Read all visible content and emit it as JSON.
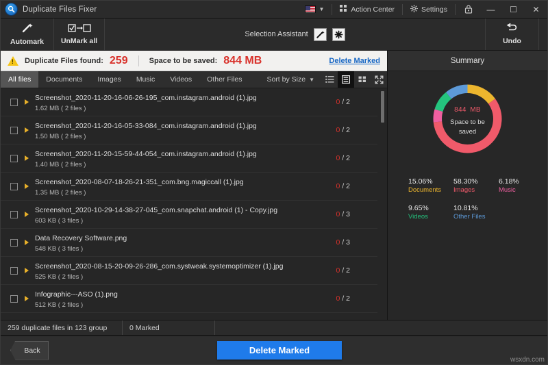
{
  "window": {
    "title": "Duplicate Files Fixer",
    "logo_icon": "magnifier-logo-icon",
    "lang_icon": "us-flag-icon",
    "action_center_label": "Action Center",
    "action_center_icon": "grid-icon",
    "settings_label": "Settings",
    "settings_icon": "gear-icon",
    "help_icon": "help-lock-icon",
    "minimize_icon": "—",
    "maximize_icon": "☐",
    "close_icon": "✕"
  },
  "toolbar": {
    "automark_label": "Automark",
    "automark_icon": "magic-wand-icon",
    "unmark_all_label": "UnMark all",
    "unmark_all_icon": "checkbox-to-empty-icon",
    "selection_assistant_label": "Selection Assistant",
    "selection_assistant_wand_icon": "magic-wand-icon",
    "selection_assistant_star_icon": "asterisk-icon",
    "undo_label": "Undo",
    "undo_icon": "undo-arrow-icon"
  },
  "notice": {
    "warning_icon": "warning-triangle-icon",
    "found_label": "Duplicate Files found:",
    "found_value": "259",
    "space_label": "Space to be saved:",
    "space_value": "844 MB",
    "delete_marked_link": "Delete Marked"
  },
  "tabs": {
    "items": [
      {
        "label": "All files",
        "active": true
      },
      {
        "label": "Documents",
        "active": false
      },
      {
        "label": "Images",
        "active": false
      },
      {
        "label": "Music",
        "active": false
      },
      {
        "label": "Videos",
        "active": false
      },
      {
        "label": "Other Files",
        "active": false
      }
    ],
    "sort_label": "Sort by Size",
    "sort_caret_icon": "chevron-down-icon",
    "views": [
      {
        "name": "list-view-icon",
        "active": false
      },
      {
        "name": "detail-view-icon",
        "active": true
      },
      {
        "name": "grid-view-icon",
        "active": false
      },
      {
        "name": "expand-view-icon",
        "active": false
      }
    ]
  },
  "file_list": {
    "rows": [
      {
        "name": "Screenshot_2020-11-20-16-06-26-195_com.instagram.android (1).jpg",
        "meta": "1.62 MB  ( 2 files )",
        "marked": "0",
        "total": "2"
      },
      {
        "name": "Screenshot_2020-11-20-16-05-33-084_com.instagram.android (1).jpg",
        "meta": "1.50 MB  ( 2 files )",
        "marked": "0",
        "total": "2"
      },
      {
        "name": "Screenshot_2020-11-20-15-59-44-054_com.instagram.android (1).jpg",
        "meta": "1.40 MB  ( 2 files )",
        "marked": "0",
        "total": "2"
      },
      {
        "name": "Screenshot_2020-08-07-18-26-21-351_com.bng.magiccall (1).jpg",
        "meta": "1.35 MB  ( 2 files )",
        "marked": "0",
        "total": "2"
      },
      {
        "name": "Screenshot_2020-10-29-14-38-27-045_com.snapchat.android (1) - Copy.jpg",
        "meta": "603 KB  ( 3 files )",
        "marked": "0",
        "total": "3"
      },
      {
        "name": "Data Recovery Software.png",
        "meta": "548 KB  ( 3 files )",
        "marked": "0",
        "total": "3"
      },
      {
        "name": "Screenshot_2020-08-15-20-09-26-286_com.systweak.systemoptimizer (1).jpg",
        "meta": "525 KB  ( 2 files )",
        "marked": "0",
        "total": "2"
      },
      {
        "name": "Infographic---ASO (1).png",
        "meta": "512 KB  ( 2 files )",
        "marked": "0",
        "total": "2"
      }
    ]
  },
  "summary": {
    "title": "Summary",
    "center_value": "844",
    "center_unit": "MB",
    "center_caption_1": "Space to be",
    "center_caption_2": "saved"
  },
  "chart_data": {
    "type": "pie",
    "title": "Summary",
    "subtitle": "844 MB Space to be saved",
    "categories": [
      "Documents",
      "Images",
      "Music",
      "Videos",
      "Other Files"
    ],
    "values": [
      15.06,
      58.3,
      6.18,
      9.65,
      10.81
    ],
    "value_labels": [
      "15.06%",
      "58.30%",
      "6.18%",
      "9.65%",
      "10.81%"
    ],
    "colors": [
      "#edb62e",
      "#f05a6a",
      "#ef5fa0",
      "#24c47e",
      "#5d9ad8"
    ],
    "unit": "%",
    "donut": true,
    "legend_position": "below",
    "total_label": "844 MB"
  },
  "statusbar": {
    "files_text": "259 duplicate files in 123 group",
    "marked_text": "0 Marked",
    "extra_text": ""
  },
  "footer": {
    "back_label": "Back",
    "delete_label": "Delete Marked",
    "watermark": "wsxdn.com"
  }
}
